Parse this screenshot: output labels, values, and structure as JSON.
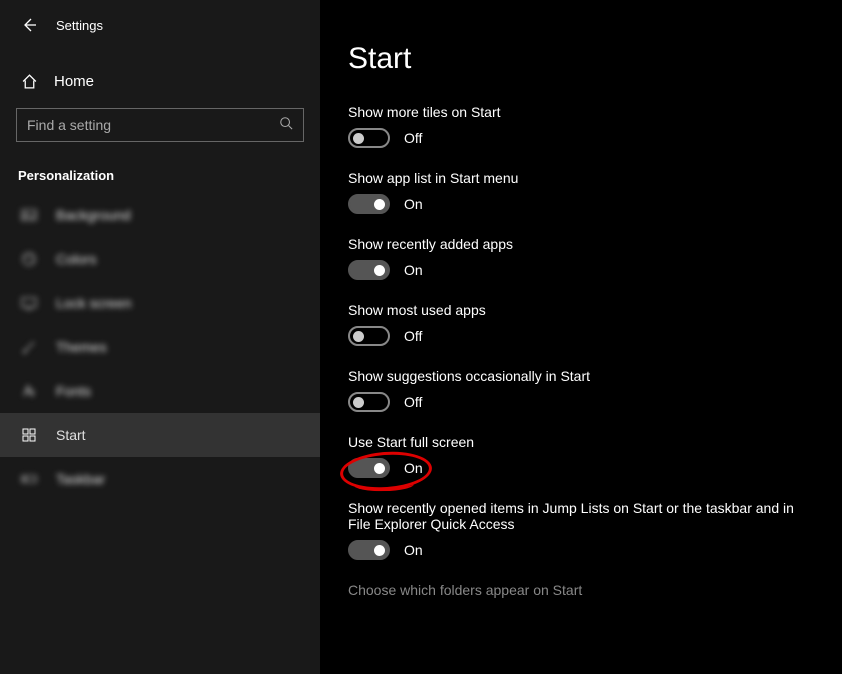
{
  "header": {
    "title": "Settings"
  },
  "home": {
    "label": "Home"
  },
  "search": {
    "placeholder": "Find a setting"
  },
  "category": "Personalization",
  "nav": [
    {
      "label": "Background"
    },
    {
      "label": "Colors"
    },
    {
      "label": "Lock screen"
    },
    {
      "label": "Themes"
    },
    {
      "label": "Fonts"
    },
    {
      "label": "Start"
    },
    {
      "label": "Taskbar"
    }
  ],
  "main": {
    "title": "Start",
    "settings": [
      {
        "label": "Show more tiles on Start",
        "on": false,
        "state": "Off"
      },
      {
        "label": "Show app list in Start menu",
        "on": true,
        "state": "On"
      },
      {
        "label": "Show recently added apps",
        "on": true,
        "state": "On"
      },
      {
        "label": "Show most used apps",
        "on": false,
        "state": "Off"
      },
      {
        "label": "Show suggestions occasionally in Start",
        "on": false,
        "state": "Off"
      },
      {
        "label": "Use Start full screen",
        "on": true,
        "state": "On",
        "highlighted": true
      },
      {
        "label": "Show recently opened items in Jump Lists on Start or the taskbar and in File Explorer Quick Access",
        "on": true,
        "state": "On"
      }
    ],
    "link": "Choose which folders appear on Start"
  }
}
